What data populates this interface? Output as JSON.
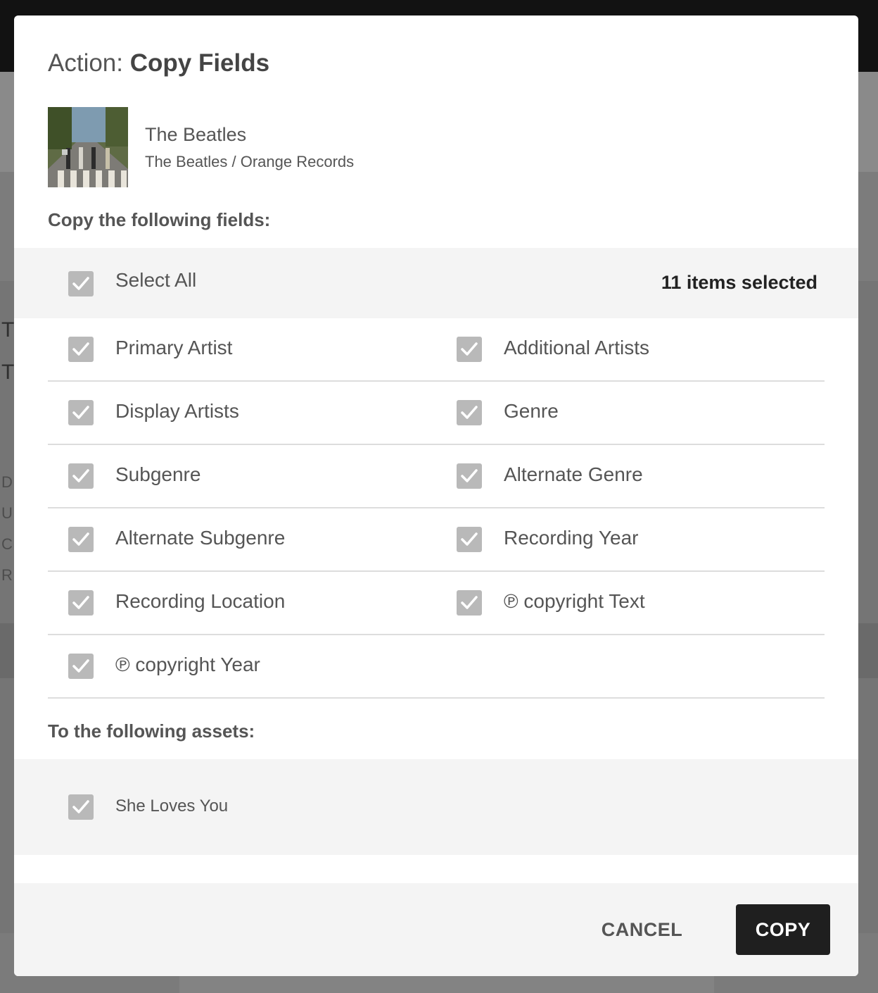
{
  "modal": {
    "title_prefix": "Action: ",
    "title_action": "Copy Fields",
    "album": {
      "name": "The Beatles",
      "subtitle": "The Beatles / Orange Records"
    },
    "copy_fields_label": "Copy the following fields:",
    "select_all": {
      "label": "Select All",
      "checked": true,
      "count_text": "11 items selected"
    },
    "fields": [
      {
        "label": "Primary Artist",
        "checked": true
      },
      {
        "label": "Additional Artists",
        "checked": true
      },
      {
        "label": "Display Artists",
        "checked": true
      },
      {
        "label": "Genre",
        "checked": true
      },
      {
        "label": "Subgenre",
        "checked": true
      },
      {
        "label": "Alternate Genre",
        "checked": true
      },
      {
        "label": "Alternate Subgenre",
        "checked": true
      },
      {
        "label": "Recording Year",
        "checked": true
      },
      {
        "label": "Recording Location",
        "checked": true
      },
      {
        "label": "℗ copyright Text",
        "checked": true
      },
      {
        "label": "℗ copyright Year",
        "checked": true
      }
    ],
    "assets_label": "To the following assets:",
    "assets": [
      {
        "label": "She Loves You",
        "checked": true
      }
    ],
    "buttons": {
      "cancel": "CANCEL",
      "copy": "COPY"
    }
  },
  "background": {
    "letters": [
      "T",
      "T",
      "D",
      "U",
      "C",
      "R"
    ]
  },
  "colors": {
    "checkbox": "#b9b9b9",
    "primary_button": "#1f1f1f",
    "panel_gray": "#f4f4f4"
  }
}
